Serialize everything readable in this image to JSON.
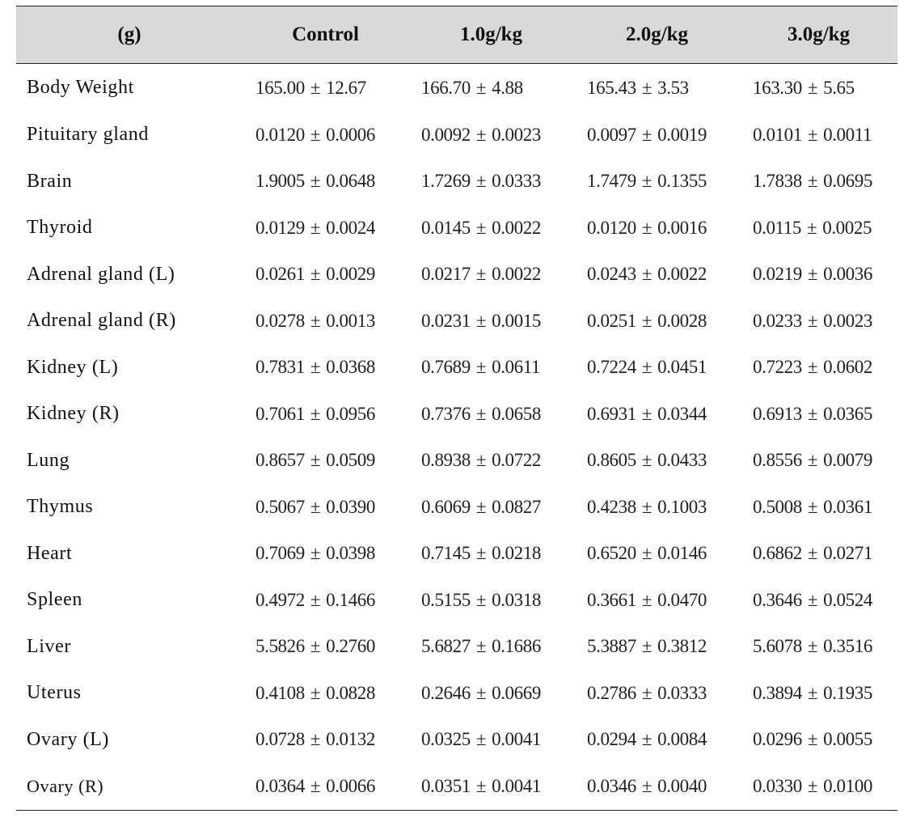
{
  "table": {
    "headers": [
      "(g)",
      "Control",
      "1.0g/kg",
      "2.0g/kg",
      "3.0g/kg"
    ],
    "rows": [
      {
        "label": "Body Weight",
        "cells": [
          {
            "mean": "165.00",
            "sd": "12.67"
          },
          {
            "mean": "166.70",
            "sd": "4.88"
          },
          {
            "mean": "165.43",
            "sd": "3.53"
          },
          {
            "mean": "163.30",
            "sd": "5.65"
          }
        ]
      },
      {
        "label": "Pituitary gland",
        "cells": [
          {
            "mean": "0.0120",
            "sd": "0.0006"
          },
          {
            "mean": "0.0092",
            "sd": "0.0023"
          },
          {
            "mean": "0.0097",
            "sd": "0.0019"
          },
          {
            "mean": "0.0101",
            "sd": "0.0011"
          }
        ]
      },
      {
        "label": "Brain",
        "cells": [
          {
            "mean": "1.9005",
            "sd": "0.0648"
          },
          {
            "mean": "1.7269",
            "sd": "0.0333"
          },
          {
            "mean": "1.7479",
            "sd": "0.1355"
          },
          {
            "mean": "1.7838",
            "sd": "0.0695"
          }
        ]
      },
      {
        "label": "Thyroid",
        "cells": [
          {
            "mean": "0.0129",
            "sd": "0.0024"
          },
          {
            "mean": "0.0145",
            "sd": "0.0022"
          },
          {
            "mean": "0.0120",
            "sd": "0.0016"
          },
          {
            "mean": "0.0115",
            "sd": "0.0025"
          }
        ]
      },
      {
        "label": "Adrenal gland (L)",
        "cells": [
          {
            "mean": "0.0261",
            "sd": "0.0029"
          },
          {
            "mean": "0.0217",
            "sd": "0.0022"
          },
          {
            "mean": "0.0243",
            "sd": "0.0022"
          },
          {
            "mean": "0.0219",
            "sd": "0.0036"
          }
        ]
      },
      {
        "label": "Adrenal gland (R)",
        "cells": [
          {
            "mean": "0.0278",
            "sd": "0.0013"
          },
          {
            "mean": "0.0231",
            "sd": "0.0015"
          },
          {
            "mean": "0.0251",
            "sd": "0.0028"
          },
          {
            "mean": "0.0233",
            "sd": "0.0023"
          }
        ]
      },
      {
        "label": "Kidney (L)",
        "cells": [
          {
            "mean": "0.7831",
            "sd": "0.0368"
          },
          {
            "mean": "0.7689",
            "sd": "0.0611"
          },
          {
            "mean": "0.7224",
            "sd": "0.0451"
          },
          {
            "mean": "0.7223",
            "sd": "0.0602"
          }
        ]
      },
      {
        "label": "Kidney (R)",
        "cells": [
          {
            "mean": "0.7061",
            "sd": "0.0956"
          },
          {
            "mean": "0.7376",
            "sd": "0.0658"
          },
          {
            "mean": "0.6931",
            "sd": "0.0344"
          },
          {
            "mean": "0.6913",
            "sd": "0.0365"
          }
        ]
      },
      {
        "label": "Lung",
        "cells": [
          {
            "mean": "0.8657",
            "sd": "0.0509"
          },
          {
            "mean": "0.8938",
            "sd": "0.0722"
          },
          {
            "mean": "0.8605",
            "sd": "0.0433"
          },
          {
            "mean": "0.8556",
            "sd": "0.0079"
          }
        ]
      },
      {
        "label": "Thymus",
        "cells": [
          {
            "mean": "0.5067",
            "sd": "0.0390"
          },
          {
            "mean": "0.6069",
            "sd": "0.0827"
          },
          {
            "mean": "0.4238",
            "sd": "0.1003"
          },
          {
            "mean": "0.5008",
            "sd": "0.0361"
          }
        ]
      },
      {
        "label": "Heart",
        "cells": [
          {
            "mean": "0.7069",
            "sd": "0.0398"
          },
          {
            "mean": "0.7145",
            "sd": "0.0218"
          },
          {
            "mean": "0.6520",
            "sd": "0.0146"
          },
          {
            "mean": "0.6862",
            "sd": "0.0271"
          }
        ]
      },
      {
        "label": "Spleen",
        "cells": [
          {
            "mean": "0.4972",
            "sd": "0.1466"
          },
          {
            "mean": "0.5155",
            "sd": "0.0318"
          },
          {
            "mean": "0.3661",
            "sd": "0.0470"
          },
          {
            "mean": "0.3646",
            "sd": "0.0524"
          }
        ]
      },
      {
        "label": "Liver",
        "cells": [
          {
            "mean": "5.5826",
            "sd": "0.2760"
          },
          {
            "mean": "5.6827",
            "sd": "0.1686"
          },
          {
            "mean": "5.3887",
            "sd": "0.3812"
          },
          {
            "mean": "5.6078",
            "sd": "0.3516"
          }
        ]
      },
      {
        "label": "Uterus",
        "cells": [
          {
            "mean": "0.4108",
            "sd": "0.0828"
          },
          {
            "mean": "0.2646",
            "sd": "0.0669"
          },
          {
            "mean": "0.2786",
            "sd": "0.0333"
          },
          {
            "mean": "0.3894",
            "sd": "0.1935"
          }
        ]
      },
      {
        "label": "Ovary (L)",
        "cells": [
          {
            "mean": "0.0728",
            "sd": "0.0132"
          },
          {
            "mean": "0.0325",
            "sd": "0.0041"
          },
          {
            "mean": "0.0294",
            "sd": "0.0084"
          },
          {
            "mean": "0.0296",
            "sd": "0.0055"
          }
        ]
      },
      {
        "label": "Ovary (R)",
        "cells": [
          {
            "mean": "0.0364",
            "sd": "0.0066"
          },
          {
            "mean": "0.0351",
            "sd": "0.0041"
          },
          {
            "mean": "0.0346",
            "sd": "0.0040"
          },
          {
            "mean": "0.0330",
            "sd": "0.0100"
          }
        ]
      }
    ],
    "pm_symbol": "±",
    "colors": {
      "header_bg": "#d9d9d9",
      "rule": "#222222",
      "text": "#111111"
    }
  }
}
